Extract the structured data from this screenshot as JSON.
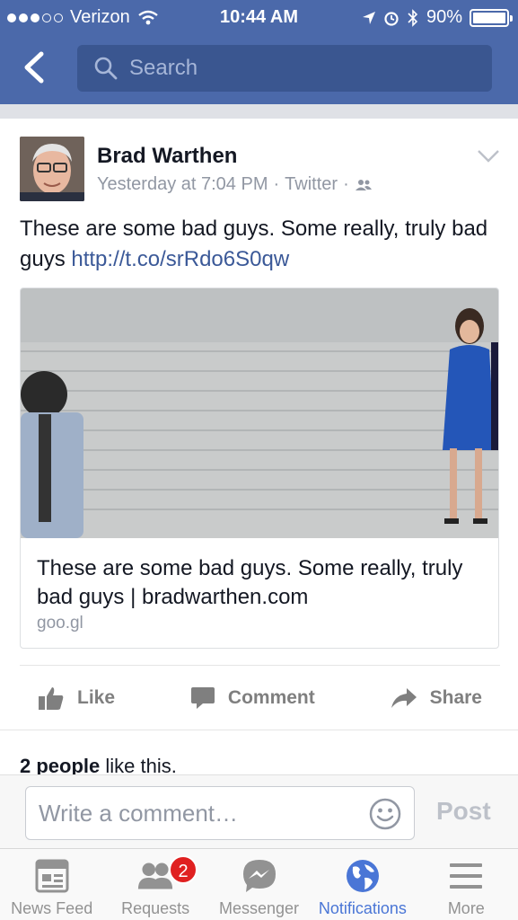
{
  "status_bar": {
    "carrier": "Verizon",
    "time": "10:44 AM",
    "battery": "90%",
    "battery_level": 0.9
  },
  "header": {
    "search_placeholder": "Search"
  },
  "post": {
    "author": "Brad Warthen",
    "timestamp": "Yesterday at 7:04 PM",
    "source": "Twitter",
    "text": "These are some bad guys. Some really, truly bad guys",
    "link_text": "http://t.co/srRdo6S0qw",
    "link_preview": {
      "title": "These are some bad guys. Some really, truly bad guys | bradwarthen.com",
      "domain": "goo.gl"
    },
    "actions": {
      "like": "Like",
      "comment": "Comment",
      "share": "Share"
    },
    "likes_count": "2 people",
    "likes_suffix": " like this."
  },
  "comment_bar": {
    "placeholder": "Write a comment…",
    "post_label": "Post"
  },
  "tabs": [
    {
      "label": "News Feed",
      "icon": "news-feed-icon"
    },
    {
      "label": "Requests",
      "icon": "friend-requests-icon",
      "badge": "2"
    },
    {
      "label": "Messenger",
      "icon": "messenger-icon"
    },
    {
      "label": "Notifications",
      "icon": "globe-icon",
      "active": true
    },
    {
      "label": "More",
      "icon": "menu-icon"
    }
  ],
  "colors": {
    "header_blue": "#4b69aa",
    "link_blue": "#3b5998",
    "active_tab": "#4a76d6",
    "badge_red": "#e02020"
  }
}
